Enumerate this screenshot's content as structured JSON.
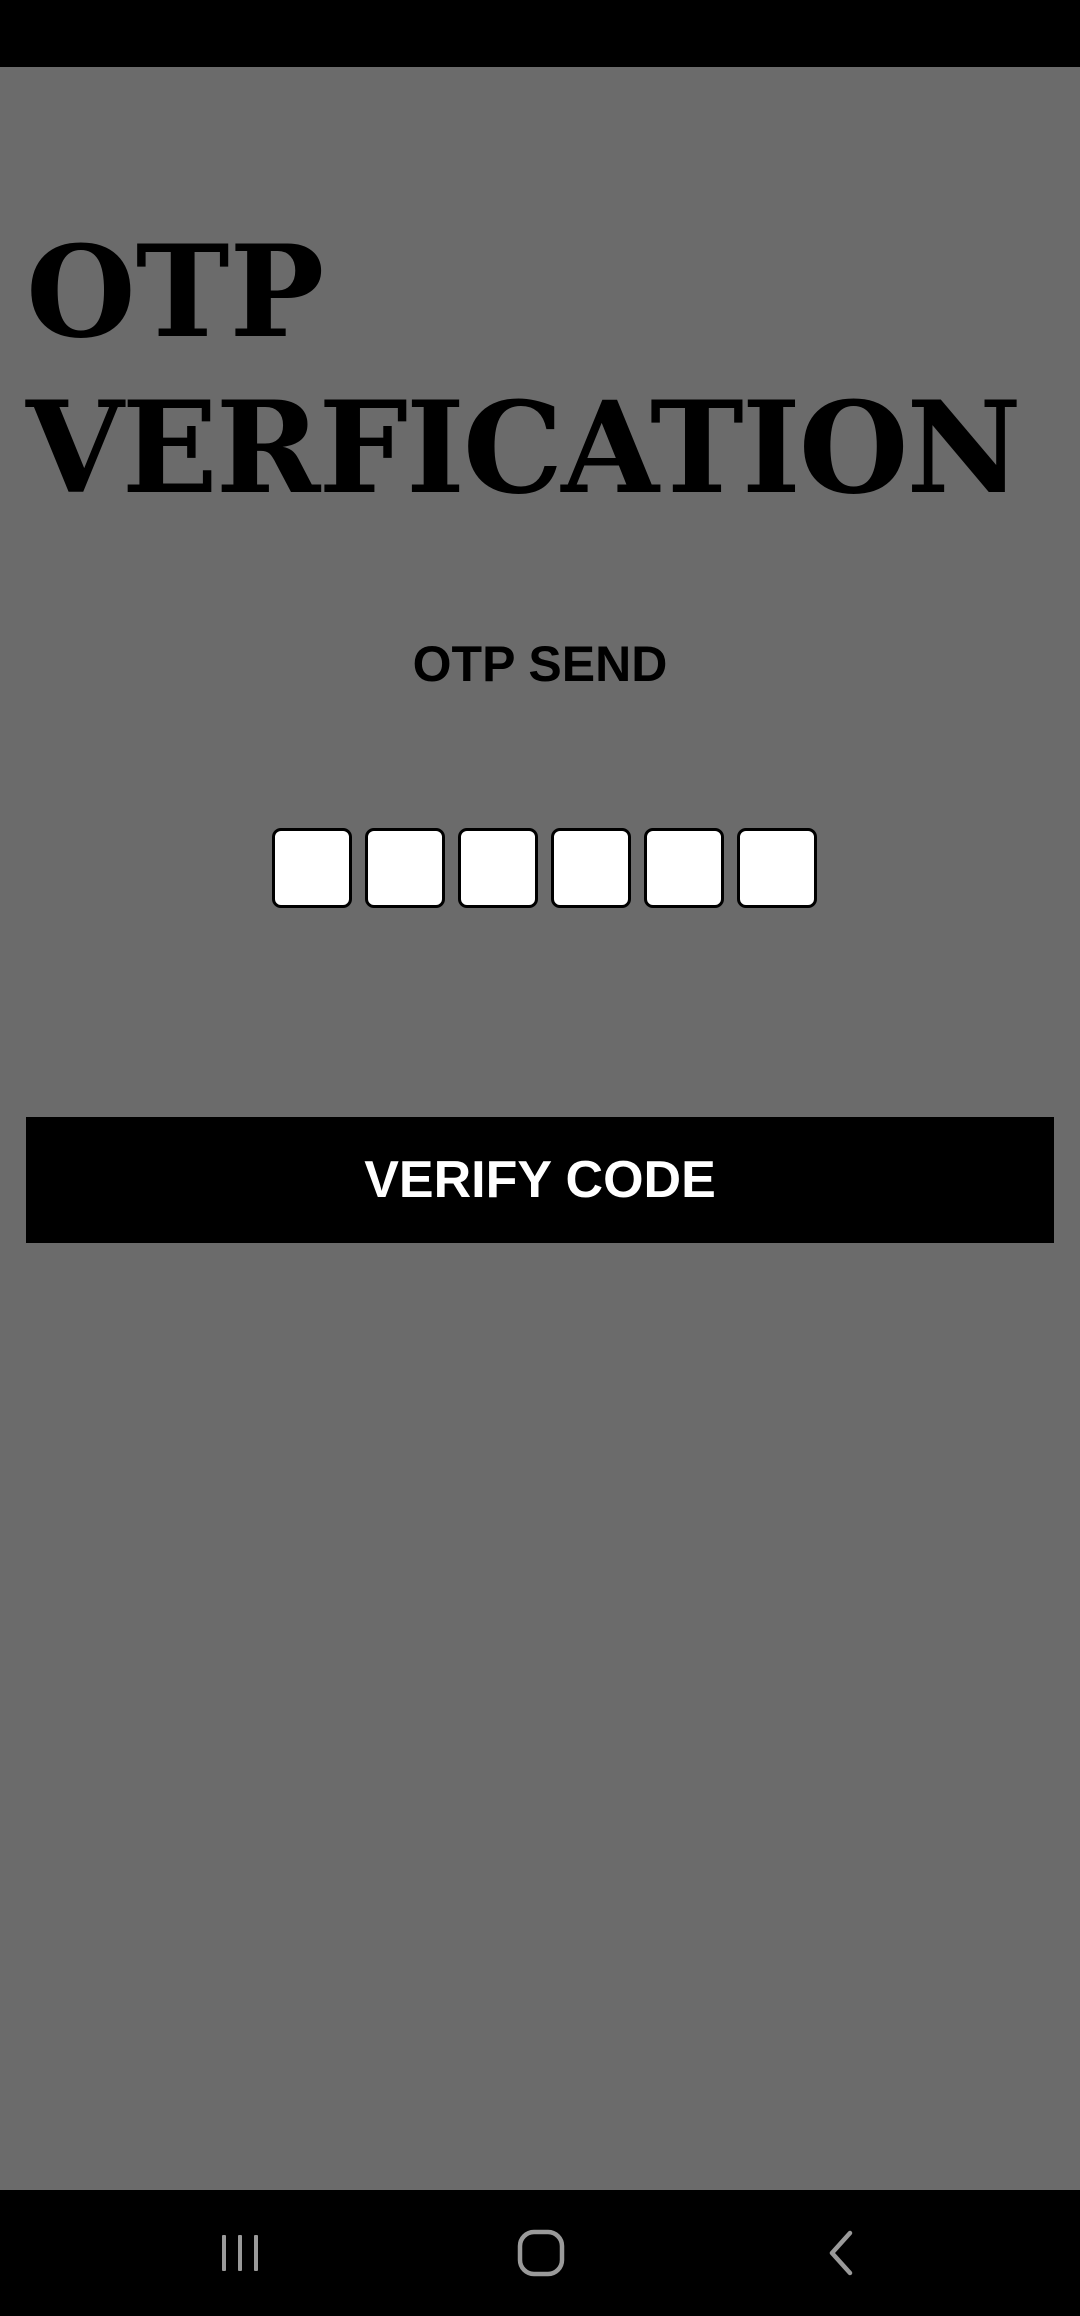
{
  "app": {
    "title_line_1": "OTP",
    "title_line_2": "VERFICATION",
    "subtitle": "OTP SEND"
  },
  "otp": {
    "digit_count": 6,
    "values": [
      "",
      "",
      "",
      "",
      "",
      ""
    ]
  },
  "actions": {
    "verify_label": "VERIFY CODE"
  },
  "navigation": {
    "recents_icon": "recents-icon",
    "home_icon": "home-icon",
    "back_icon": "back-icon"
  },
  "colors": {
    "background": "#6b6b6b",
    "bars": "#000000",
    "button": "#000000",
    "button_text": "#ffffff",
    "otp_box_fill": "#ffffff",
    "otp_box_border": "#000000",
    "nav_icon": "#9a9a9a"
  }
}
